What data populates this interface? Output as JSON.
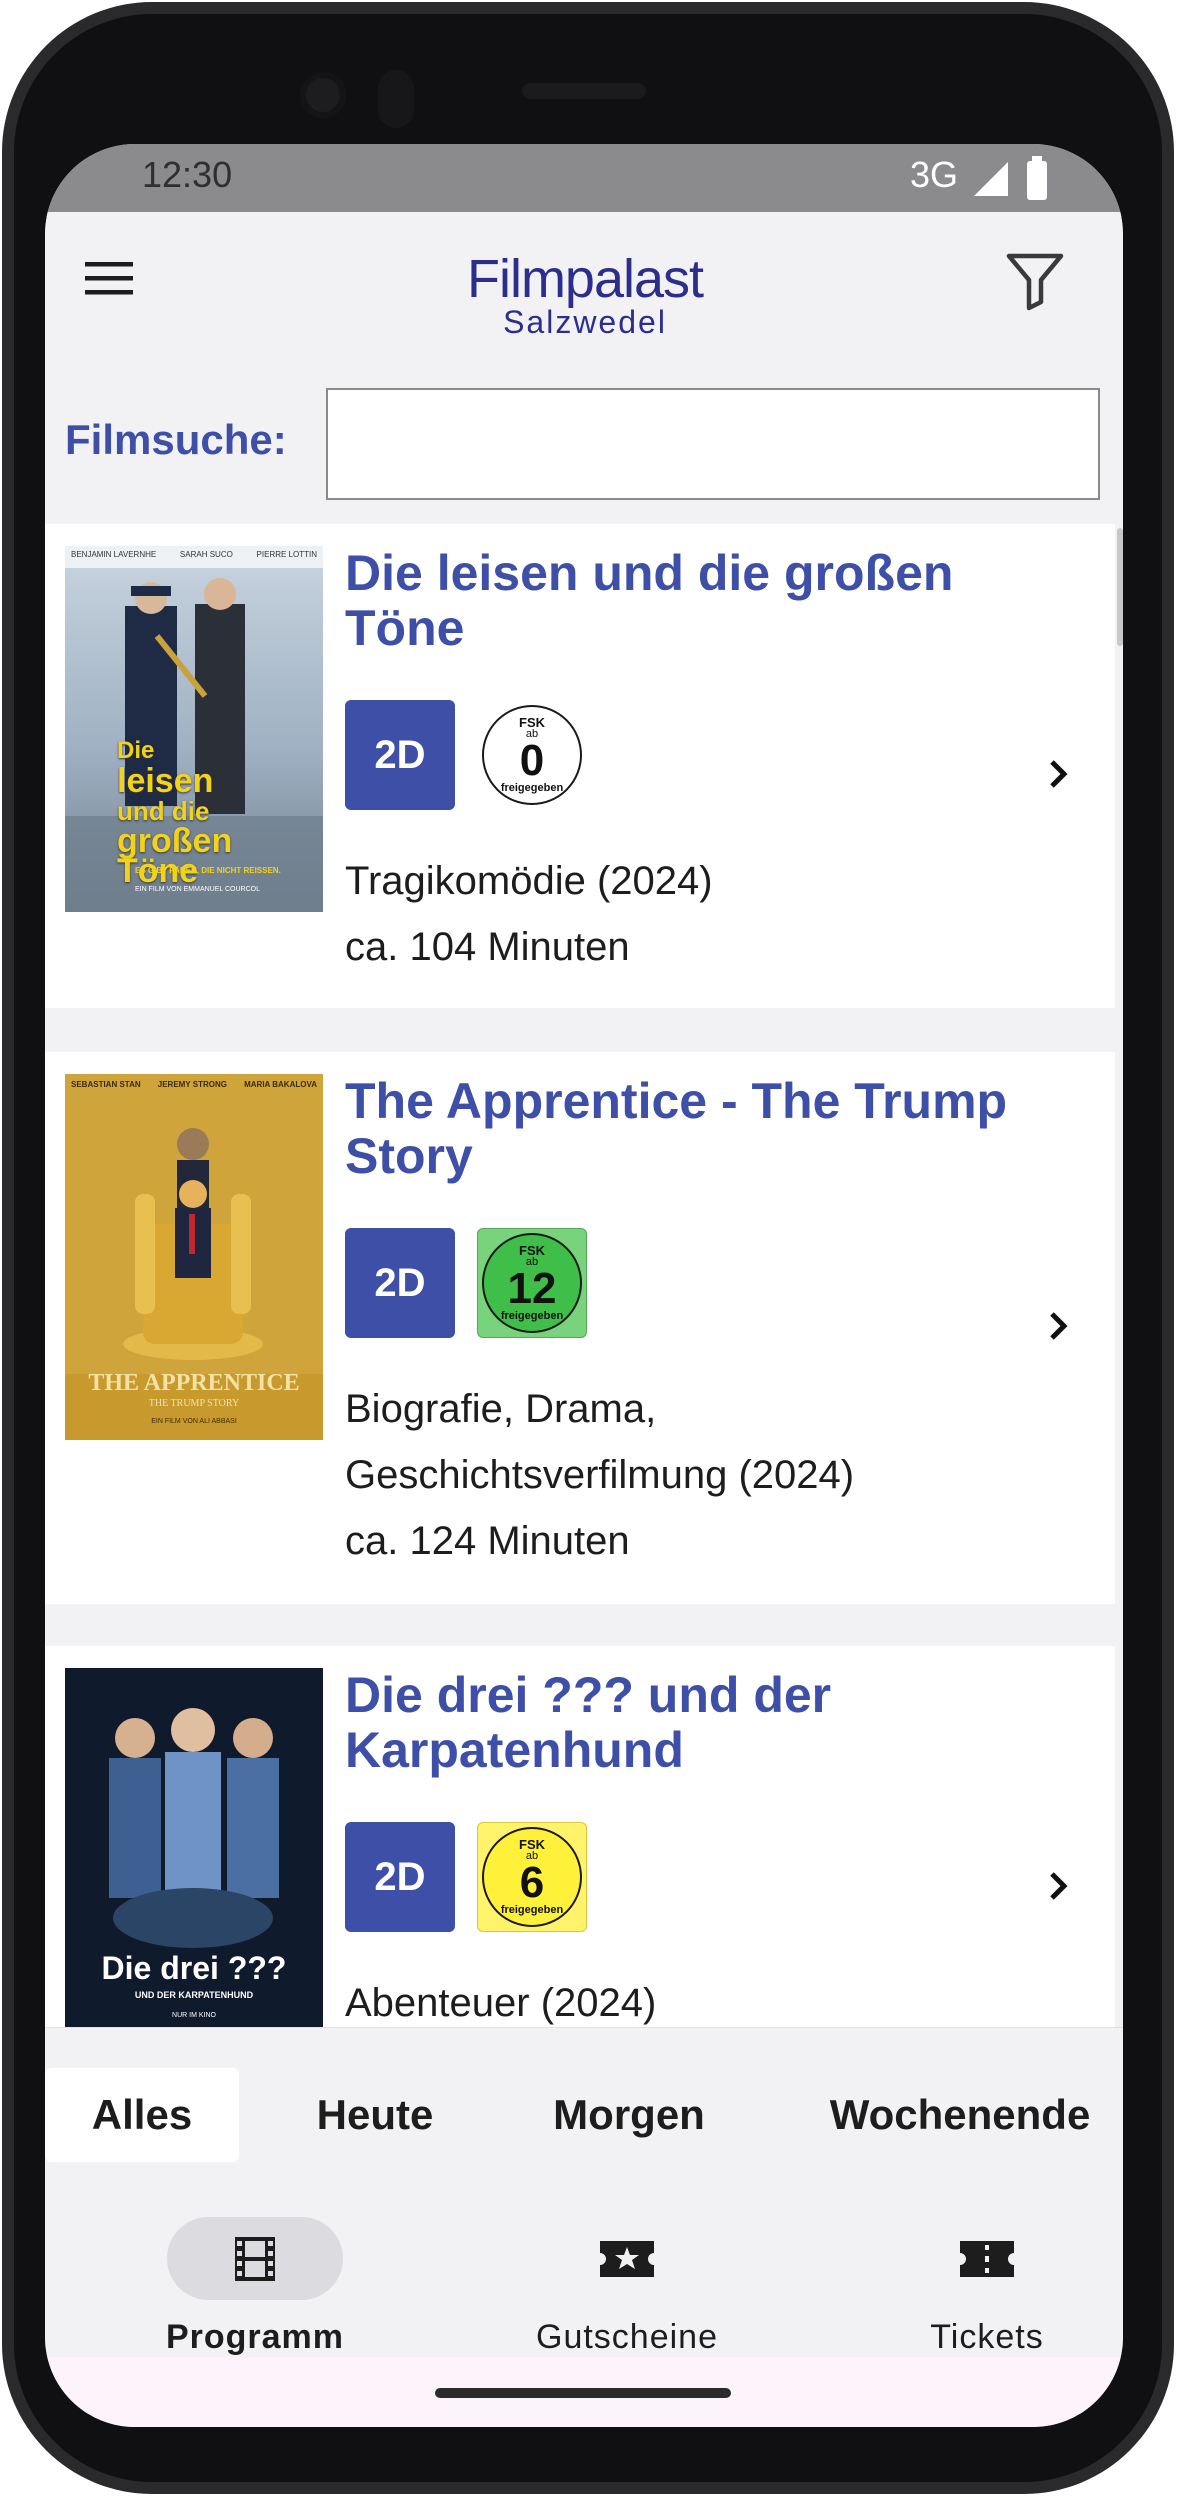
{
  "status_bar": {
    "time": "12:30",
    "network": "3G"
  },
  "header": {
    "logo_line1": "Filmpalast",
    "logo_line2": "Salzwedel"
  },
  "search": {
    "label": "Filmsuche:",
    "value": "",
    "placeholder": ""
  },
  "movies": [
    {
      "title": "Die leisen und die großen Töne",
      "format": "2D",
      "fsk": {
        "top": "FSK",
        "ab": "ab",
        "age": "0",
        "bottom": "freigegeben",
        "color": "#ffffff"
      },
      "genre_year": "Tragikomödie (2024)",
      "genre_year_2": "",
      "duration": "ca. 104 Minuten",
      "poster": {
        "actors": [
          "BENJAMIN LAVERNHE",
          "SARAH SUCO",
          "PIERRE LOTTIN"
        ],
        "title_lines": [
          "Die",
          "leisen",
          "und die",
          "großen",
          "Töne"
        ],
        "tagline": "ES GIBT FÄDEN, DIE NICHT REISSEN.",
        "director": "EIN FILM VON EMMANUEL COURCOL"
      }
    },
    {
      "title": "The Apprentice - The Trump Story",
      "format": "2D",
      "fsk": {
        "top": "FSK",
        "ab": "ab",
        "age": "12",
        "bottom": "freigegeben",
        "color": "#3fbf4a"
      },
      "genre_year": "Biografie, Drama,",
      "genre_year_2": "Geschichtsverfilmung (2024)",
      "duration": "ca. 124 Minuten",
      "poster": {
        "actors": [
          "SEBASTIAN STAN",
          "JEREMY STRONG",
          "MARIA BAKALOVA"
        ],
        "title_lines": [
          "THE APPRENTICE"
        ],
        "tagline": "THE TRUMP STORY",
        "director": "EIN FILM VON ALI ABBASI"
      }
    },
    {
      "title": "Die drei ??? und der Karpatenhund",
      "format": "2D",
      "fsk": {
        "top": "FSK",
        "ab": "ab",
        "age": "6",
        "bottom": "freigegeben",
        "color": "#fff03a"
      },
      "genre_year": "Abenteuer (2024)",
      "genre_year_2": "",
      "duration": "",
      "poster": {
        "actors": [],
        "title_lines": [
          "Die drei ???"
        ],
        "tagline": "UND DER KARPATENHUND",
        "director": "NUR IM KINO"
      }
    }
  ],
  "day_tabs": [
    {
      "label": "Alles",
      "active": true
    },
    {
      "label": "Heute",
      "active": false
    },
    {
      "label": "Morgen",
      "active": false
    },
    {
      "label": "Wochenende",
      "active": false
    }
  ],
  "bottom_nav": [
    {
      "label": "Programm",
      "icon": "film-icon",
      "active": true
    },
    {
      "label": "Gutscheine",
      "icon": "ticket-star-icon",
      "active": false
    },
    {
      "label": "Tickets",
      "icon": "ticket-icon",
      "active": false
    }
  ],
  "colors": {
    "accent": "#3d4fa6",
    "logo": "#2c2e8c"
  }
}
